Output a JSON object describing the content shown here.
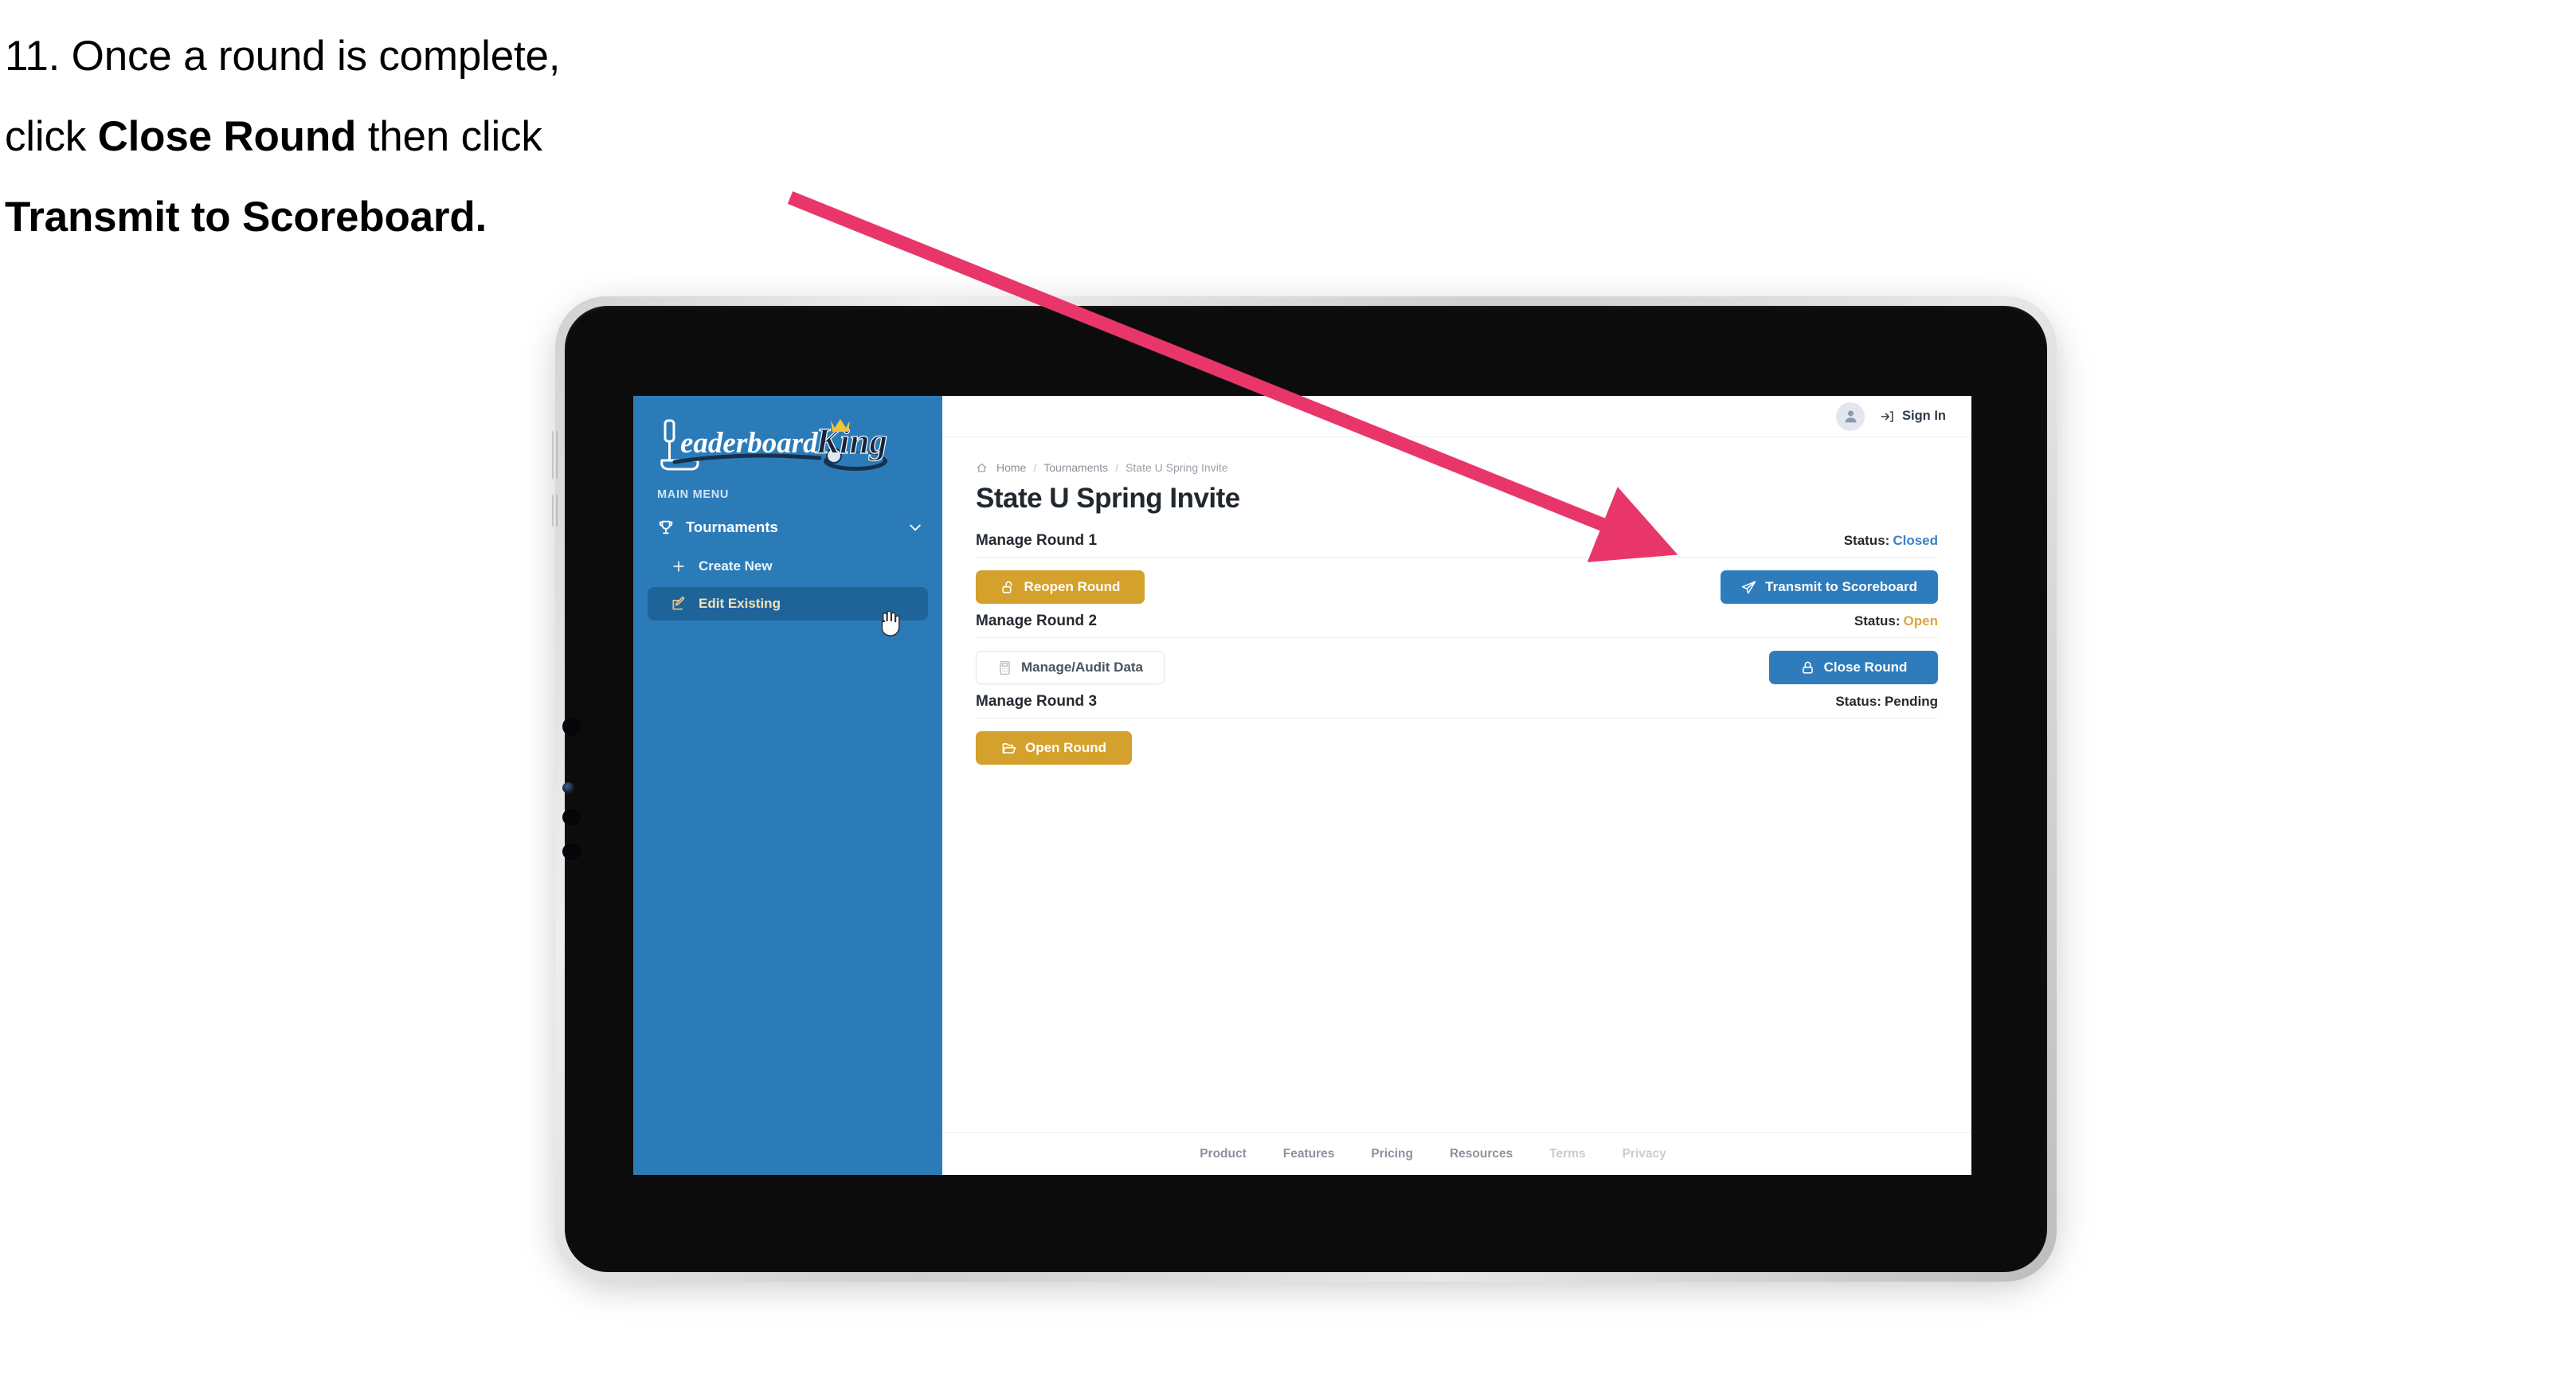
{
  "instruction": {
    "line1_prefix": "11. Once a round is complete,",
    "line2_prefix": "click ",
    "line2_bold": "Close Round",
    "line2_suffix": " then click",
    "line3_bold": "Transmit to Scoreboard."
  },
  "colors": {
    "sidebar_blue": "#2c7bb9",
    "sidebar_active": "#1f6499",
    "brand_gold": "#d4a12c",
    "brand_blue": "#2f7cbd",
    "status_closed": "#3b82c4",
    "status_open": "#e0a43a",
    "status_pending": "#242a31",
    "arrow_pink": "#e8366b"
  },
  "sidebar": {
    "logo_text_primary": "Leaderboard",
    "logo_text_secondary": "King",
    "menu_label": "MAIN MENU",
    "items": [
      {
        "label": "Tournaments",
        "icon": "trophy-icon",
        "chevron": "chevron-down-icon",
        "active": false
      },
      {
        "label": "Create New",
        "icon": "plus-icon",
        "active": false
      },
      {
        "label": "Edit Existing",
        "icon": "edit-square-icon",
        "active": true
      }
    ]
  },
  "topbar": {
    "avatar_icon": "user-avatar-icon",
    "signin_label": "Sign In",
    "signin_icon": "login-arrow-icon"
  },
  "breadcrumb": {
    "home_icon": "home-icon",
    "items": [
      "Home",
      "Tournaments",
      "State U Spring Invite"
    ],
    "separator": "/"
  },
  "page": {
    "title": "State U Spring Invite"
  },
  "rounds": [
    {
      "title": "Manage Round 1",
      "status_label": "Status:",
      "status_value": "Closed",
      "status_color": "#3b82c4",
      "left_button": {
        "label": "Reopen Round",
        "icon": "unlock-icon",
        "style": "gold"
      },
      "right_button": {
        "label": "Transmit to Scoreboard",
        "icon": "paper-plane-icon",
        "style": "blue"
      }
    },
    {
      "title": "Manage Round 2",
      "status_label": "Status:",
      "status_value": "Open",
      "status_color": "#e0a43a",
      "left_button": {
        "label": "Manage/Audit Data",
        "icon": "calculator-icon",
        "style": "ghost"
      },
      "right_button": {
        "label": "Close Round",
        "icon": "lock-icon",
        "style": "blue"
      }
    },
    {
      "title": "Manage Round 3",
      "status_label": "Status:",
      "status_value": "Pending",
      "status_color": "#242a31",
      "left_button": {
        "label": "Open Round",
        "icon": "open-folder-icon",
        "style": "gold"
      },
      "right_button": null
    }
  ],
  "footer": {
    "links": [
      {
        "label": "Product",
        "dim": false
      },
      {
        "label": "Features",
        "dim": false
      },
      {
        "label": "Pricing",
        "dim": false
      },
      {
        "label": "Resources",
        "dim": false
      },
      {
        "label": "Terms",
        "dim": true
      },
      {
        "label": "Privacy",
        "dim": true
      }
    ]
  },
  "annotation": {
    "arrow_name": "callout-arrow",
    "cursor_name": "hand-cursor"
  }
}
